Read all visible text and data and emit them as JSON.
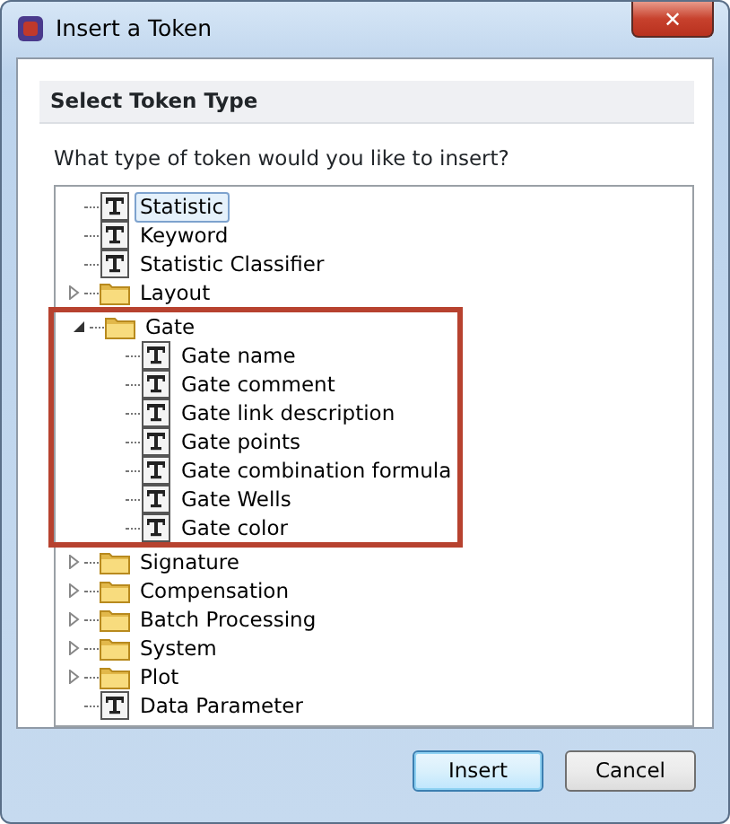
{
  "window": {
    "title": "Insert a Token",
    "close": "✕"
  },
  "section": {
    "title": "Select Token Type"
  },
  "prompt": "What type of token would you like to insert?",
  "tree": [
    {
      "kind": "token",
      "label": "Statistic",
      "selected": true
    },
    {
      "kind": "token",
      "label": "Keyword",
      "selected": false
    },
    {
      "kind": "token",
      "label": "Statistic Classifier",
      "selected": false
    },
    {
      "kind": "folder",
      "label": "Layout",
      "selected": false,
      "expanded": false
    },
    {
      "kind": "folder",
      "label": "Gate",
      "selected": false,
      "expanded": true,
      "highlighted": true,
      "children": [
        {
          "kind": "token",
          "label": "Gate name",
          "selected": false
        },
        {
          "kind": "token",
          "label": "Gate comment",
          "selected": false
        },
        {
          "kind": "token",
          "label": "Gate link description",
          "selected": false
        },
        {
          "kind": "token",
          "label": "Gate points",
          "selected": false
        },
        {
          "kind": "token",
          "label": "Gate combination formula",
          "selected": false
        },
        {
          "kind": "token",
          "label": "Gate Wells",
          "selected": false
        },
        {
          "kind": "token",
          "label": "Gate color",
          "selected": false
        }
      ]
    },
    {
      "kind": "folder",
      "label": "Signature",
      "selected": false,
      "expanded": false
    },
    {
      "kind": "folder",
      "label": "Compensation",
      "selected": false,
      "expanded": false
    },
    {
      "kind": "folder",
      "label": "Batch Processing",
      "selected": false,
      "expanded": false
    },
    {
      "kind": "folder",
      "label": "System",
      "selected": false,
      "expanded": false
    },
    {
      "kind": "folder",
      "label": "Plot",
      "selected": false,
      "expanded": false
    },
    {
      "kind": "token",
      "label": "Data Parameter",
      "selected": false
    }
  ],
  "buttons": [
    {
      "label": "Insert",
      "default": true
    },
    {
      "label": "Cancel",
      "default": false
    }
  ]
}
